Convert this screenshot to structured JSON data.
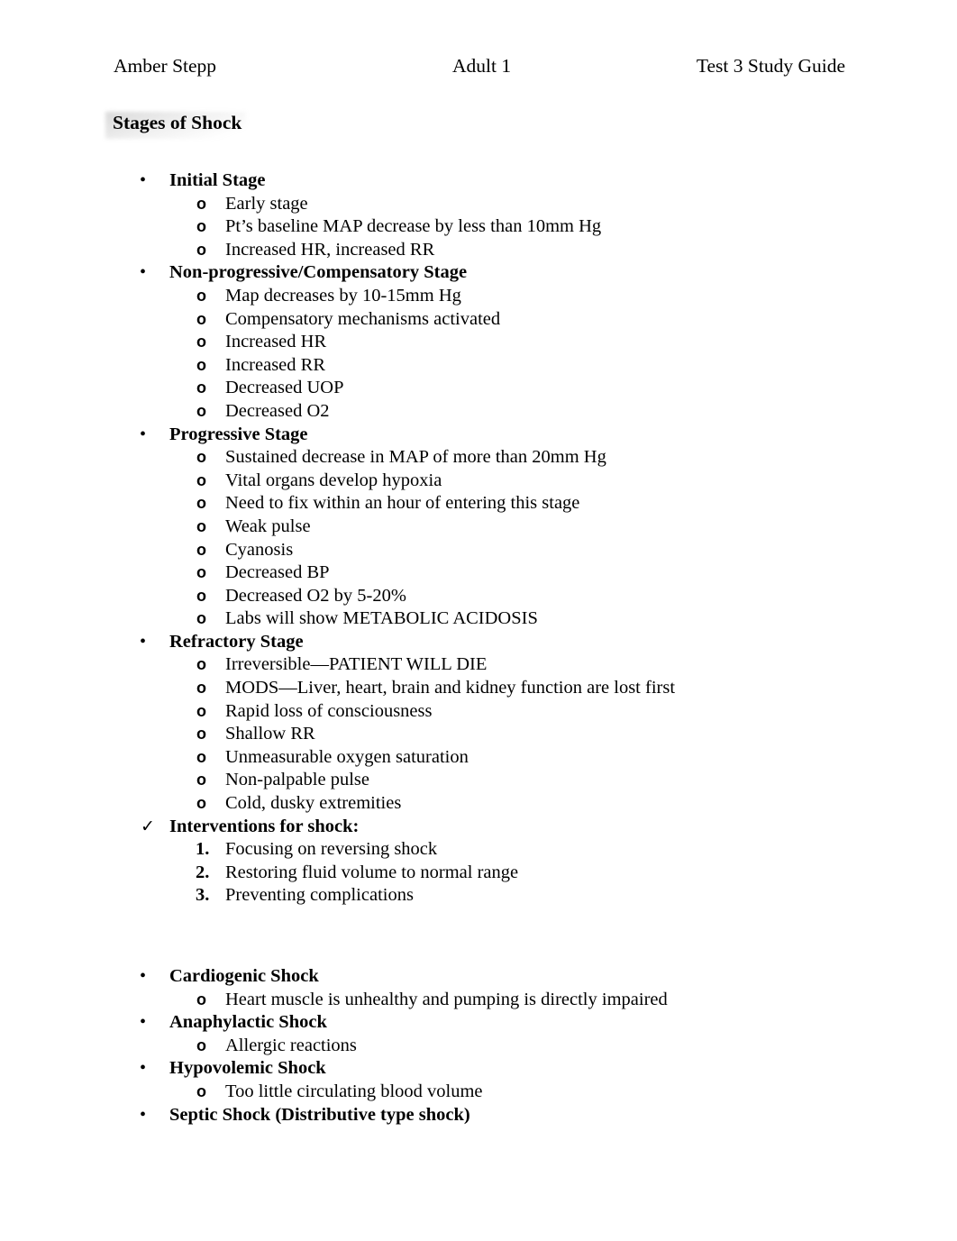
{
  "header": {
    "left": "Amber Stepp",
    "center": "Adult 1",
    "right": "Test 3 Study Guide"
  },
  "section": {
    "title": "Stages of Shock"
  },
  "markers": {
    "disc": "•",
    "circle": "o",
    "check": "✓"
  },
  "outline": [
    {
      "level": 1,
      "marker": "disc",
      "text": "Initial Stage"
    },
    {
      "level": 2,
      "marker": "circle",
      "text": "Early stage"
    },
    {
      "level": 2,
      "marker": "circle",
      "text": "Pt’s baseline MAP decrease by less than 10mm Hg"
    },
    {
      "level": 2,
      "marker": "circle",
      "text": "Increased HR, increased RR"
    },
    {
      "level": 1,
      "marker": "disc",
      "text": "Non-progressive/Compensatory Stage"
    },
    {
      "level": 2,
      "marker": "circle",
      "text": "Map decreases by 10-15mm Hg"
    },
    {
      "level": 2,
      "marker": "circle",
      "text": "Compensatory mechanisms activated"
    },
    {
      "level": 2,
      "marker": "circle",
      "text": "Increased HR"
    },
    {
      "level": 2,
      "marker": "circle",
      "text": "Increased RR"
    },
    {
      "level": 2,
      "marker": "circle",
      "text": "Decreased UOP"
    },
    {
      "level": 2,
      "marker": "circle",
      "text": "Decreased O2"
    },
    {
      "level": 1,
      "marker": "disc",
      "text": "Progressive Stage"
    },
    {
      "level": 2,
      "marker": "circle",
      "text": "Sustained decrease in MAP of more than 20mm Hg"
    },
    {
      "level": 2,
      "marker": "circle",
      "text": "Vital organs develop hypoxia"
    },
    {
      "level": 2,
      "marker": "circle",
      "text": "Need to fix within an hour of entering this stage"
    },
    {
      "level": 2,
      "marker": "circle",
      "text": "Weak pulse"
    },
    {
      "level": 2,
      "marker": "circle",
      "text": "Cyanosis"
    },
    {
      "level": 2,
      "marker": "circle",
      "text": "Decreased BP"
    },
    {
      "level": 2,
      "marker": "circle",
      "text": "Decreased O2 by 5-20%"
    },
    {
      "level": 2,
      "marker": "circle",
      "text": "Labs will show METABOLIC ACIDOSIS"
    },
    {
      "level": 1,
      "marker": "disc",
      "text": "Refractory Stage"
    },
    {
      "level": 2,
      "marker": "circle",
      "text": "Irreversible—PATIENT WILL DIE"
    },
    {
      "level": 2,
      "marker": "circle",
      "text": "MODS—Liver, heart, brain and kidney function are lost first"
    },
    {
      "level": 2,
      "marker": "circle",
      "text": "Rapid loss of consciousness"
    },
    {
      "level": 2,
      "marker": "circle",
      "text": "Shallow RR"
    },
    {
      "level": 2,
      "marker": "circle",
      "text": "Unmeasurable oxygen saturation"
    },
    {
      "level": 2,
      "marker": "circle",
      "text": "Non-palpable pulse"
    },
    {
      "level": 2,
      "marker": "circle",
      "text": "Cold, dusky extremities"
    },
    {
      "level": 1,
      "marker": "check",
      "text": "Interventions for shock:"
    },
    {
      "level": 2,
      "marker": "number",
      "number": "1.",
      "text": "Focusing on reversing shock"
    },
    {
      "level": 2,
      "marker": "number",
      "number": "2.",
      "text": "Restoring fluid volume to normal range"
    },
    {
      "level": 2,
      "marker": "number",
      "number": "3.",
      "text": "Preventing complications"
    },
    {
      "level": 0,
      "marker": "gap-big",
      "text": ""
    },
    {
      "level": 1,
      "marker": "disc",
      "text": "Cardiogenic Shock"
    },
    {
      "level": 2,
      "marker": "circle",
      "text": "Heart muscle is unhealthy and pumping is directly impaired"
    },
    {
      "level": 1,
      "marker": "disc",
      "text": "Anaphylactic Shock"
    },
    {
      "level": 2,
      "marker": "circle",
      "text": "Allergic reactions"
    },
    {
      "level": 1,
      "marker": "disc",
      "text": "Hypovolemic Shock"
    },
    {
      "level": 2,
      "marker": "circle",
      "text": "Too little circulating blood volume"
    },
    {
      "level": 1,
      "marker": "disc",
      "text": "Septic Shock (Distributive type shock)"
    }
  ]
}
